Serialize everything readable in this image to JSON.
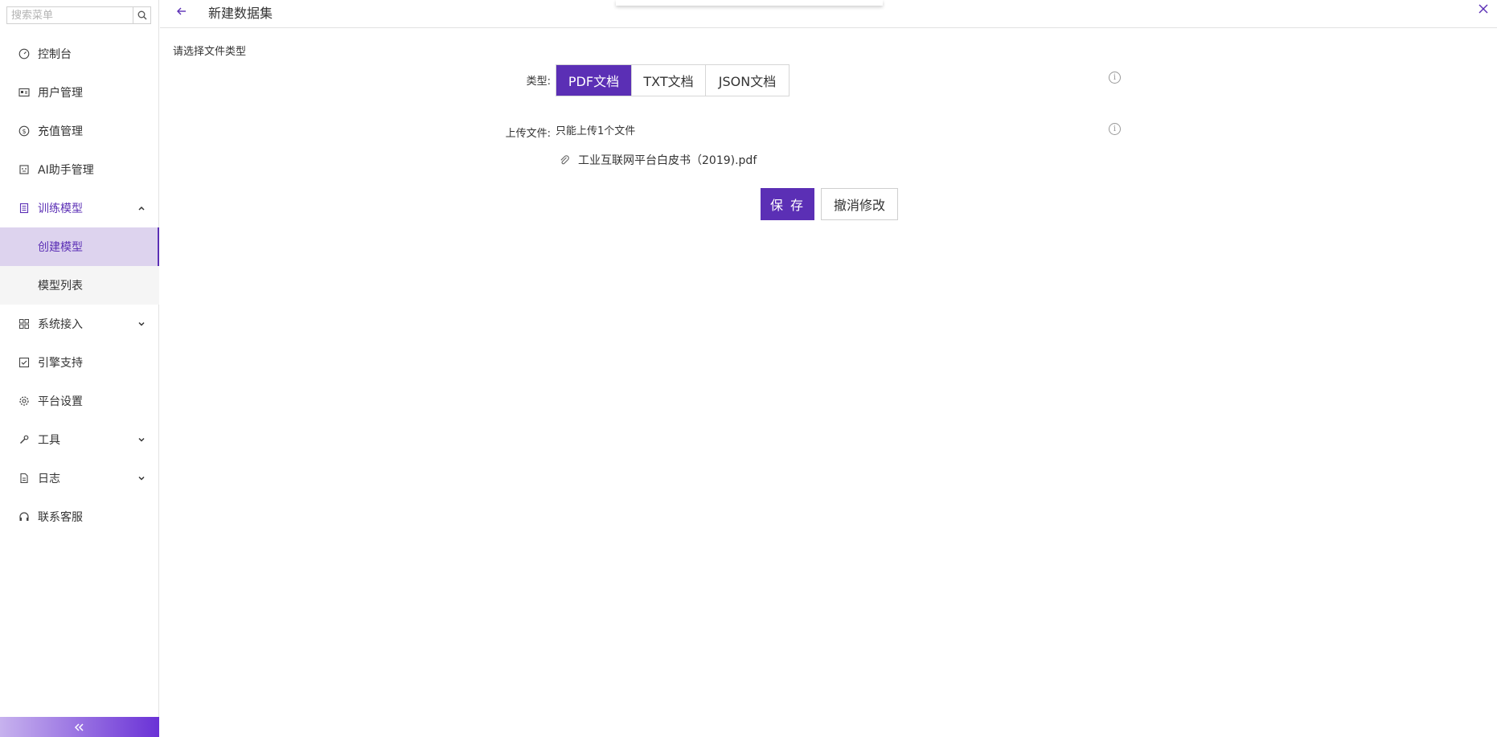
{
  "sidebar": {
    "search_placeholder": "搜索菜单",
    "items": [
      {
        "label": "控制台",
        "icon": "dashboard-icon"
      },
      {
        "label": "用户管理",
        "icon": "id-card-icon"
      },
      {
        "label": "充值管理",
        "icon": "dollar-icon"
      },
      {
        "label": "AI助手管理",
        "icon": "robot-icon"
      },
      {
        "label": "训练模型",
        "icon": "book-icon"
      },
      {
        "label": "系统接入",
        "icon": "grid-icon"
      },
      {
        "label": "引擎支持",
        "icon": "checkbox-icon"
      },
      {
        "label": "平台设置",
        "icon": "gear-icon"
      },
      {
        "label": "工具",
        "icon": "wrench-icon"
      },
      {
        "label": "日志",
        "icon": "document-icon"
      },
      {
        "label": "联系客服",
        "icon": "headset-icon"
      }
    ],
    "training_sub": [
      {
        "label": "创建模型"
      },
      {
        "label": "模型列表"
      }
    ]
  },
  "header": {
    "title": "新建数据集"
  },
  "form": {
    "section_label": "请选择文件类型",
    "type_label": "类型:",
    "type_options": [
      "PDF文档",
      "TXT文档",
      "JSON文档"
    ],
    "selected_type": "PDF文档",
    "upload_label": "上传文件:",
    "upload_hint": "只能上传1个文件",
    "file_name": "工业互联网平台白皮书（2019).pdf",
    "save_label": "保 存",
    "cancel_label": "撤消修改"
  },
  "colors": {
    "accent": "#5b2fb5",
    "active_bg": "#ddd3ee"
  }
}
